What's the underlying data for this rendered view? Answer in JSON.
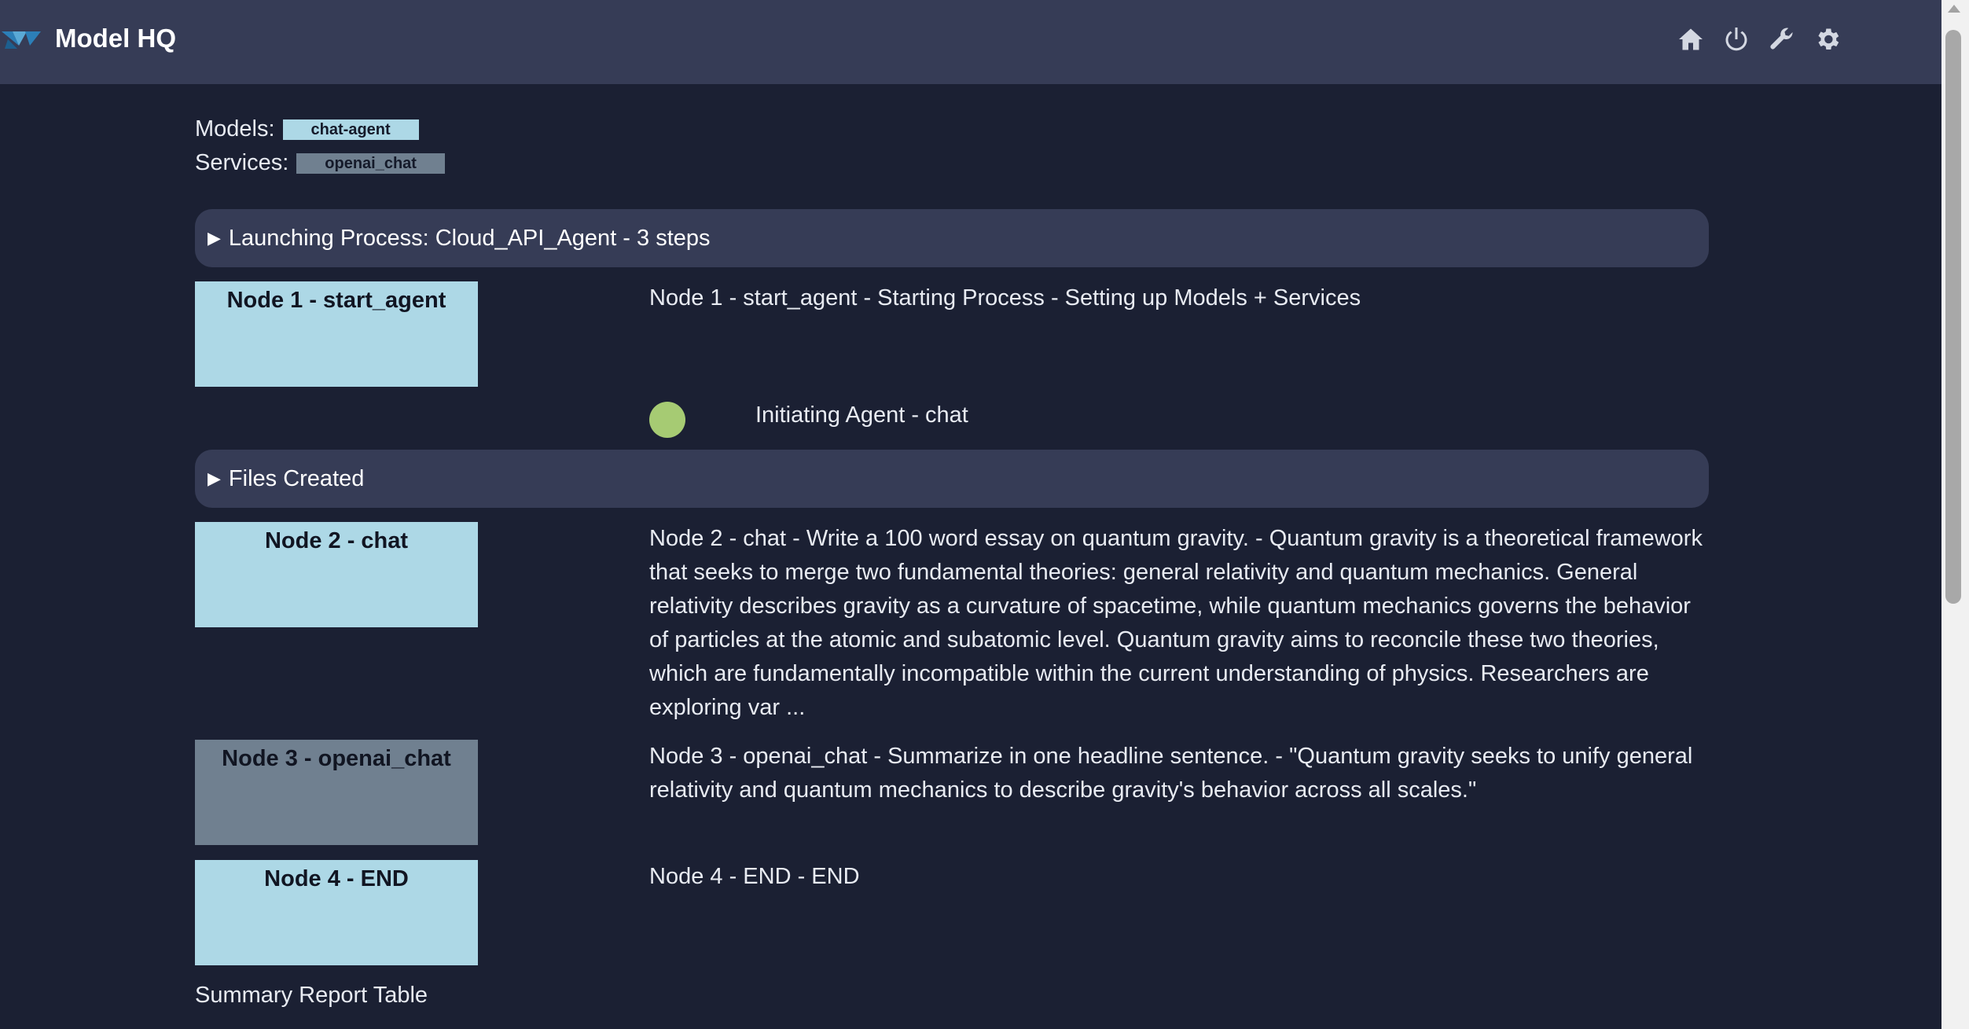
{
  "app": {
    "title": "Model HQ"
  },
  "header_icons": [
    "home-icon",
    "power-icon",
    "wrench-icon",
    "gear-icon"
  ],
  "colors": {
    "light_node": "#add8e6",
    "slate_node": "#708090",
    "status_dot": "#a6cb73",
    "background": "#1b2033",
    "bar": "#363c56"
  },
  "meta": {
    "models_label": "Models:",
    "models_value": "chat-agent",
    "services_label": "Services:",
    "services_value": "openai_chat"
  },
  "process_summary": "Launching Process: Cloud_API_Agent - 3 steps",
  "files_summary": "Files Created",
  "status": {
    "text": "Initiating Agent - chat"
  },
  "nodes": [
    {
      "label": "Node 1 - start_agent",
      "text": "Node 1 - start_agent - Starting Process - Setting up Models + Services"
    },
    {
      "label": "Node 2 - chat",
      "text": "Node 2 - chat - Write a 100 word essay on quantum gravity. - Quantum gravity is a theoretical framework that seeks to merge two fundamental theories: general relativity and quantum mechanics. General relativity describes gravity as a curvature of spacetime, while quantum mechanics governs the behavior of particles at the atomic and subatomic level. Quantum gravity aims to reconcile these two theories, which are fundamentally incompatible within the current understanding of physics. Researchers are exploring var ..."
    },
    {
      "label": "Node 3 - openai_chat",
      "text": "Node 3 - openai_chat - Summarize in one headline sentence. - \"Quantum gravity seeks to unify general relativity and quantum mechanics to describe gravity's behavior across all scales.\""
    },
    {
      "label": "Node 4 - END",
      "text": "Node 4 - END - END"
    }
  ],
  "report": {
    "title": "Summary Report Table"
  }
}
